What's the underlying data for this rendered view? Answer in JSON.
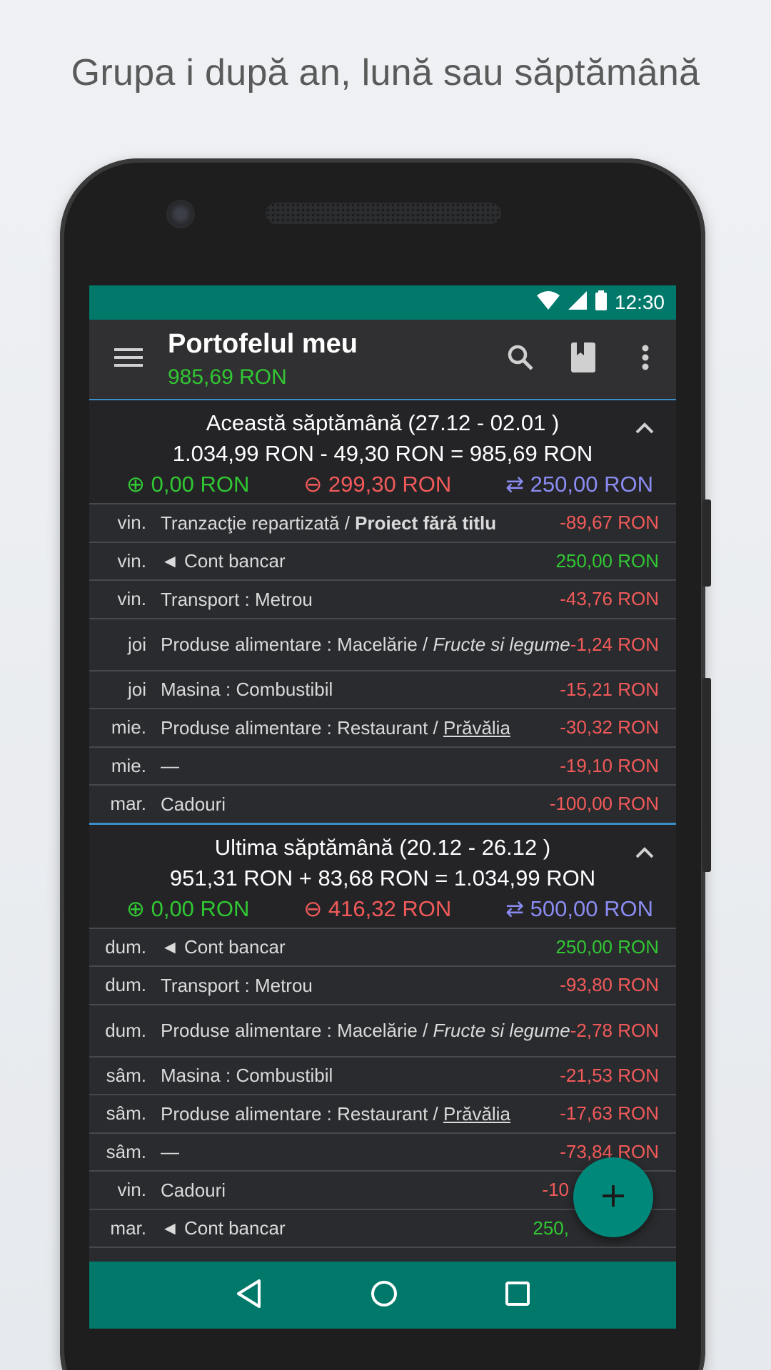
{
  "caption": "Grupa   i după an, lună sau săptămână",
  "status": {
    "time": "12:30"
  },
  "appbar": {
    "title": "Portofelul meu",
    "balance": "985,69 RON"
  },
  "groups": [
    {
      "title": "Această săptămână (27.12 - 02.01 )",
      "sum": "1.034,99 RON - 49,30 RON = 985,69 RON",
      "income": "⊕ 0,00 RON",
      "expense": "⊖ 299,30 RON",
      "transfer": "⇄ 250,00 RON",
      "rows": [
        {
          "day": "vin.",
          "desc_a": "Tranzacţie repartizată / ",
          "desc_b": "Proiect fără titlu",
          "amount": "-89,67 RON"
        },
        {
          "day": "vin.",
          "desc_a": "◄ Cont bancar",
          "amount": "250,00 RON"
        },
        {
          "day": "vin.",
          "desc_a": "Transport : Metrou",
          "amount": "-43,76 RON"
        },
        {
          "day": "joi",
          "desc_a": "Produse alimentare : Macelărie / ",
          "desc_b": "Fructe si legume",
          "amount": "-1,24 RON"
        },
        {
          "day": "joi",
          "desc_a": "Masina : Combustibil",
          "amount": "-15,21 RON"
        },
        {
          "day": "mie.",
          "desc_a": "Produse alimentare : Restaurant / ",
          "desc_b": "Prăvălia",
          "amount": "-30,32 RON"
        },
        {
          "day": "mie.",
          "desc_a": "—",
          "amount": "-19,10 RON"
        },
        {
          "day": "mar.",
          "desc_a": "Cadouri",
          "amount": "-100,00 RON"
        }
      ]
    },
    {
      "title": "Ultima săptămână (20.12 - 26.12 )",
      "sum": "951,31 RON + 83,68 RON = 1.034,99 RON",
      "income": "⊕ 0,00 RON",
      "expense": "⊖ 416,32 RON",
      "transfer": "⇄ 500,00 RON",
      "rows": [
        {
          "day": "dum.",
          "desc_a": "◄ Cont bancar",
          "amount": "250,00 RON"
        },
        {
          "day": "dum.",
          "desc_a": "Transport : Metrou",
          "amount": "-93,80 RON"
        },
        {
          "day": "dum.",
          "desc_a": "Produse alimentare : Macelărie / ",
          "desc_b": "Fructe si legume",
          "amount": "-2,78 RON"
        },
        {
          "day": "sâm.",
          "desc_a": "Masina : Combustibil",
          "amount": "-21,53 RON"
        },
        {
          "day": "sâm.",
          "desc_a": "Produse alimentare : Restaurant / ",
          "desc_b": "Prăvălia",
          "amount": "-17,63 RON"
        },
        {
          "day": "sâm.",
          "desc_a": "—",
          "amount": "-73,84 RON"
        },
        {
          "day": "vin.",
          "desc_a": "Cadouri",
          "amount": "-10"
        },
        {
          "day": "mar.",
          "desc_a": "◄ Cont bancar",
          "amount": "250,"
        }
      ]
    }
  ],
  "colors": {
    "accent": "#00796b",
    "income": "#31c733",
    "expense": "#f25a5a",
    "transfer": "#8b8cf2"
  }
}
